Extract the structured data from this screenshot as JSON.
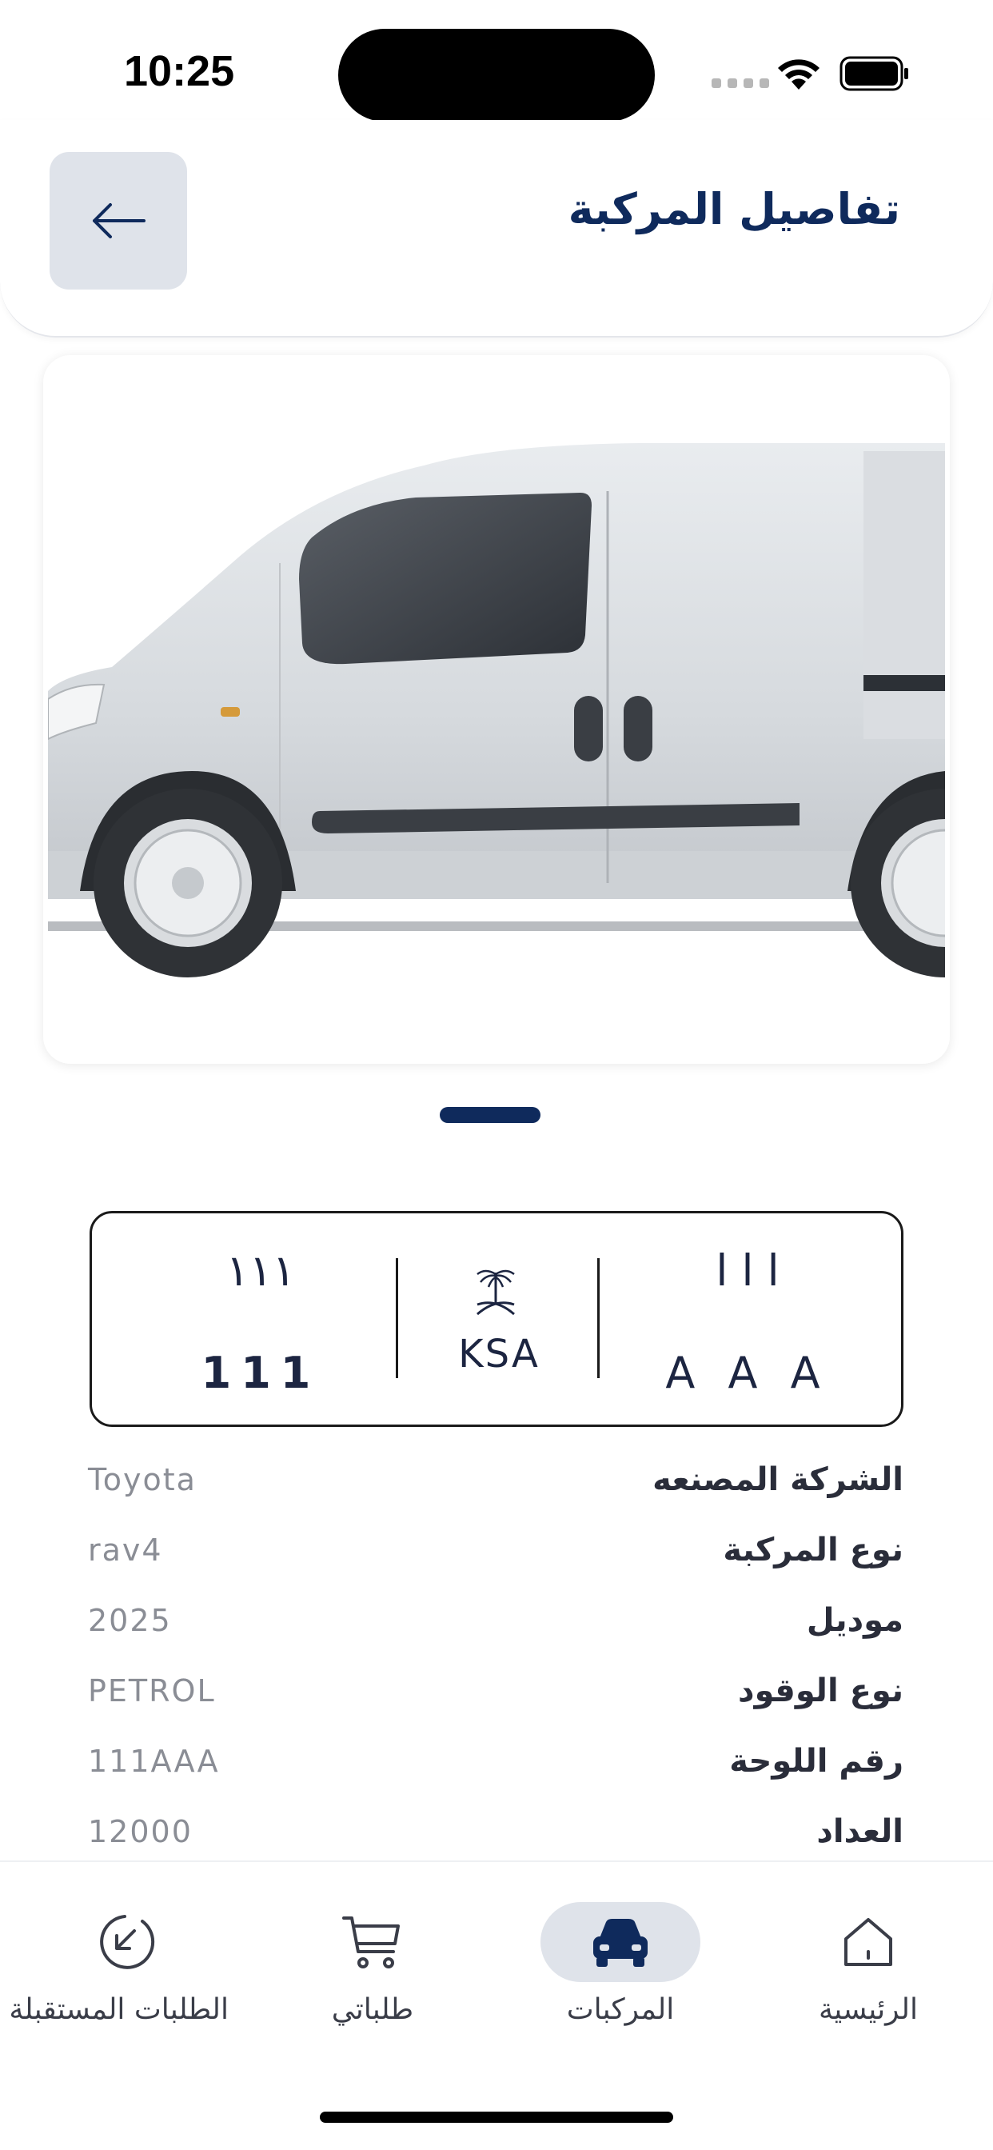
{
  "status_bar": {
    "time": "10:25"
  },
  "header": {
    "title": "تفاصيل المركبة"
  },
  "plate": {
    "left_numbers_arabic": "١١١",
    "left_numbers_latin": "111",
    "center_country": "KSA",
    "right_letters_arabic": "ا ا ا",
    "right_letters_latin": "A A A"
  },
  "details": [
    {
      "label": "الشركة المصنعه",
      "value": "Toyota"
    },
    {
      "label": "نوع المركبة",
      "value": "rav4"
    },
    {
      "label": "موديل",
      "value": "2025"
    },
    {
      "label": "نوع الوقود",
      "value": "PETROL"
    },
    {
      "label": "رقم اللوحة",
      "value": "111AAA"
    },
    {
      "label": "العداد",
      "value": "12000"
    }
  ],
  "tabs": [
    {
      "label": "الرئيسية",
      "icon": "home-icon",
      "active": false
    },
    {
      "label": "المركبات",
      "icon": "car-icon",
      "active": true
    },
    {
      "label": "طلباتي",
      "icon": "cart-icon",
      "active": false
    },
    {
      "label": "الطلبات المستقبلة",
      "icon": "history-icon",
      "active": false
    }
  ],
  "colors": {
    "primary": "#0f2a5c",
    "active_tab_bg": "#dfe3ea",
    "value_text": "#8a8d95"
  }
}
